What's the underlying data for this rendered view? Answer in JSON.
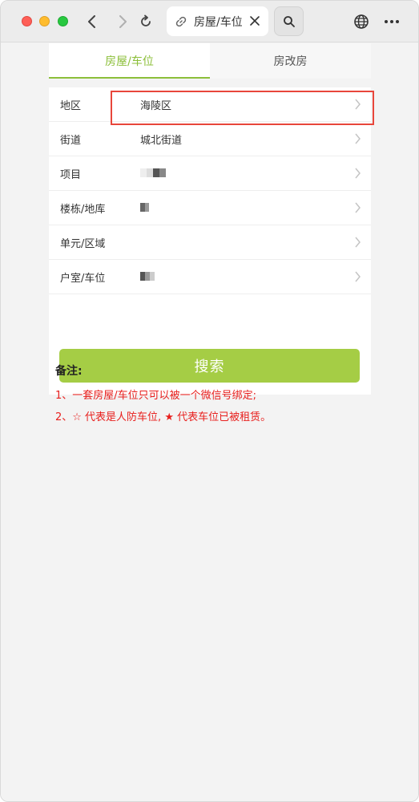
{
  "browser": {
    "tab_title": "房屋/车位",
    "icons": [
      "back-icon",
      "forward-icon",
      "reload-icon",
      "link-icon",
      "close-icon",
      "search-icon",
      "globe-icon",
      "more-icon"
    ]
  },
  "tabs": [
    {
      "label": "房屋/车位",
      "active": true
    },
    {
      "label": "房改房",
      "active": false
    }
  ],
  "form": {
    "rows": [
      {
        "label": "地区",
        "value": "海陵区"
      },
      {
        "label": "街道",
        "value": "城北街道"
      },
      {
        "label": "项目",
        "value": ""
      },
      {
        "label": "楼栋/地库",
        "value": ""
      },
      {
        "label": "单元/区域",
        "value": ""
      },
      {
        "label": "户室/车位",
        "value": ""
      }
    ],
    "search_button": "搜索"
  },
  "notes": {
    "title": "备注:",
    "line1": "1、一套房屋/车位只可以被一个微信号绑定;",
    "line2": "2、☆ 代表是人防车位, ★ 代表车位已被租赁。"
  },
  "colors": {
    "accent_green": "#a5cd45",
    "tab_active": "#8cbf3a",
    "note_red": "#e8201e",
    "highlight_red": "#e8463b"
  }
}
